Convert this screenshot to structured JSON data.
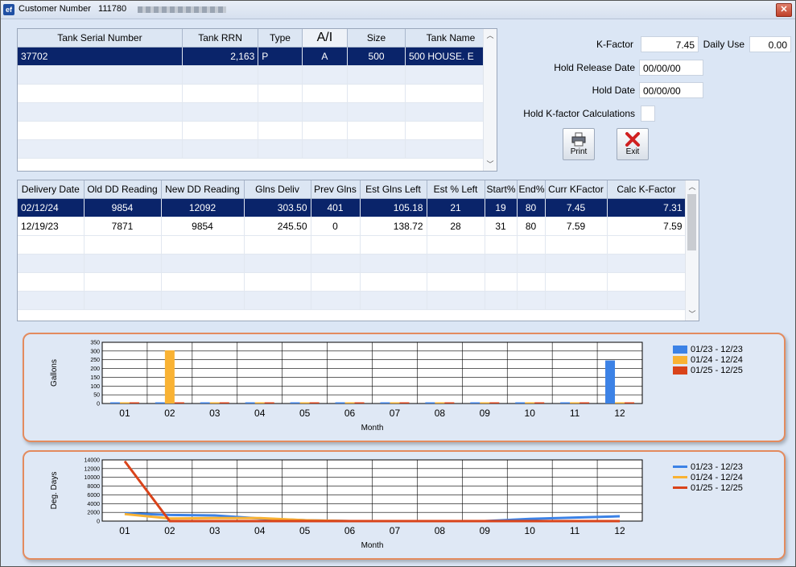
{
  "window": {
    "title": "Customer Number",
    "customer_number": "111780",
    "close_label": "✕",
    "app_icon": "ef"
  },
  "tank_grid": {
    "headers": [
      "Tank Serial Number",
      "Tank RRN",
      "Type",
      "A/I",
      "Size",
      "Tank Name"
    ],
    "rows": [
      [
        "37702",
        "2,163",
        "P",
        "A",
        "500",
        "500 HOUSE. E"
      ]
    ]
  },
  "info": {
    "kfactor_label": "K-Factor",
    "kfactor_value": "7.45",
    "daily_use_label": "Daily Use",
    "daily_use_value": "0.00",
    "hold_release_label": "Hold Release Date",
    "hold_release_value": "00/00/00",
    "hold_date_label": "Hold Date",
    "hold_date_value": "00/00/00",
    "hold_kfactor_label": "Hold K-factor Calculations",
    "print_label": "Print",
    "exit_label": "Exit"
  },
  "delivery_grid": {
    "headers": [
      "Delivery Date",
      "Old DD Reading",
      "New DD Reading",
      "Glns Deliv",
      "Prev Glns",
      "Est Glns Left",
      "Est % Left",
      "Start%",
      "End%",
      "Curr KFactor",
      "Calc K-Factor"
    ],
    "rows": [
      [
        "02/12/24",
        "9854",
        "12092",
        "303.50",
        "401",
        "105.18",
        "21",
        "19",
        "80",
        "7.45",
        "7.31"
      ],
      [
        "12/19/23",
        "7871",
        "9854",
        "245.50",
        "0",
        "138.72",
        "28",
        "31",
        "80",
        "7.59",
        "7.59"
      ]
    ]
  },
  "chart_data": [
    {
      "type": "bar",
      "ylabel": "Gallons",
      "xlabel": "Month",
      "categories": [
        "01",
        "02",
        "03",
        "04",
        "05",
        "06",
        "07",
        "08",
        "09",
        "10",
        "11",
        "12"
      ],
      "yticks": [
        "350",
        "300",
        "250",
        "200",
        "150",
        "100",
        "50",
        "0"
      ],
      "ylim": [
        0,
        350
      ],
      "series": [
        {
          "name": "01/23 - 12/23",
          "color": "#3c82e6",
          "values": [
            0,
            0,
            0,
            0,
            0,
            0,
            0,
            0,
            0,
            0,
            0,
            246
          ]
        },
        {
          "name": "01/24 - 12/24",
          "color": "#f9b233",
          "values": [
            0,
            304,
            0,
            0,
            0,
            0,
            0,
            0,
            0,
            0,
            0,
            0
          ]
        },
        {
          "name": "01/25 - 12/25",
          "color": "#d9431a",
          "values": [
            0,
            0,
            0,
            0,
            0,
            0,
            0,
            0,
            0,
            0,
            0,
            0
          ]
        }
      ],
      "legend": "top-right"
    },
    {
      "type": "line",
      "ylabel": "Deg. Days",
      "xlabel": "Month",
      "categories": [
        "01",
        "02",
        "03",
        "04",
        "05",
        "06",
        "07",
        "08",
        "09",
        "10",
        "11",
        "12"
      ],
      "yticks": [
        "14000",
        "12000",
        "10000",
        "8000",
        "6000",
        "4000",
        "2000",
        "0"
      ],
      "ylim": [
        0,
        14000
      ],
      "series": [
        {
          "name": "01/23 - 12/23",
          "color": "#3c82e6",
          "values": [
            1800,
            1400,
            1300,
            600,
            200,
            0,
            0,
            0,
            0,
            500,
            800,
            1100
          ]
        },
        {
          "name": "01/24 - 12/24",
          "color": "#f9b233",
          "values": [
            1600,
            600,
            700,
            700,
            200,
            0,
            0,
            0,
            0,
            0,
            0,
            0
          ]
        },
        {
          "name": "01/25 - 12/25",
          "color": "#d9431a",
          "values": [
            13700,
            0,
            0,
            0,
            0,
            0,
            0,
            0,
            0,
            0,
            0,
            0
          ]
        }
      ],
      "legend": "top-right"
    }
  ]
}
